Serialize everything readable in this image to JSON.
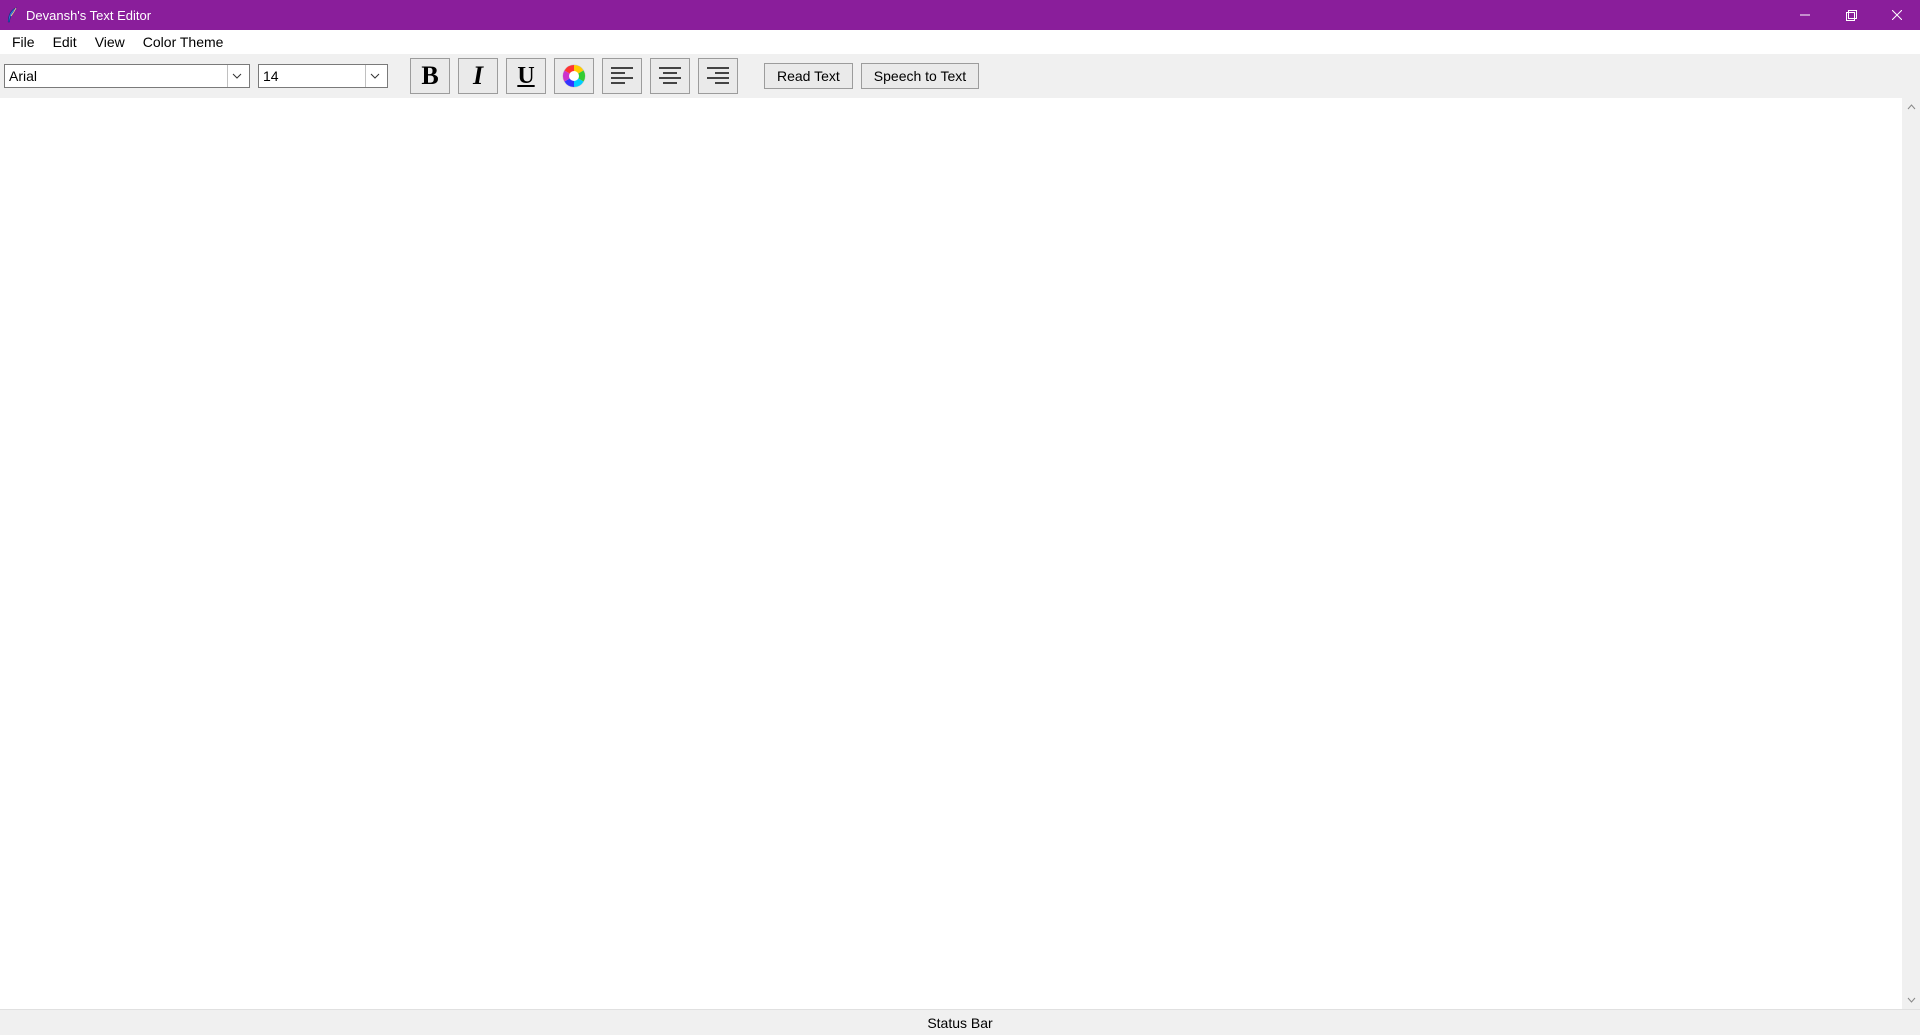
{
  "window": {
    "title": "Devansh's Text Editor"
  },
  "menubar": {
    "items": [
      "File",
      "Edit",
      "View",
      "Color Theme"
    ]
  },
  "toolbar": {
    "font_family": "Arial",
    "font_size": "14",
    "read_text_label": "Read Text",
    "speech_to_text_label": "Speech to Text"
  },
  "editor": {
    "content": ""
  },
  "statusbar": {
    "text": "Status Bar"
  }
}
